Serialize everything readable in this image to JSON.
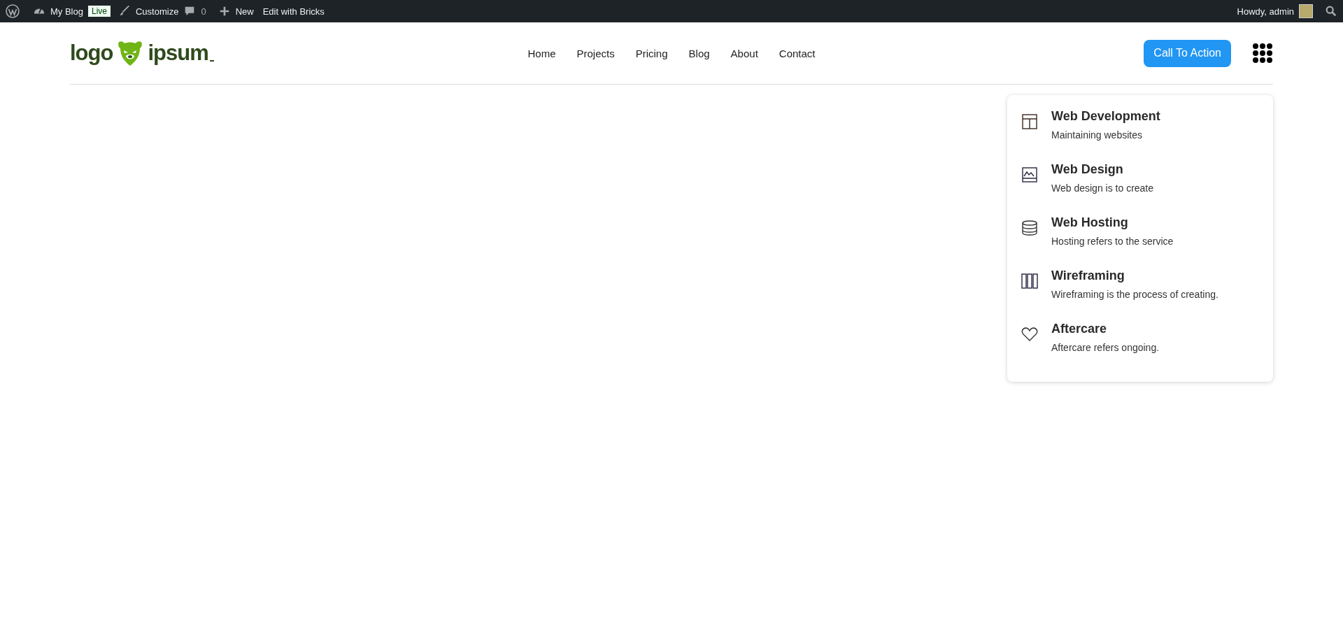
{
  "admin_bar": {
    "site": "My Blog",
    "live_badge": "Live",
    "customize": "Customize",
    "comments_count": "0",
    "new": "New",
    "edit_with_bricks": "Edit with Bricks",
    "greeting": "Howdy, admin"
  },
  "header": {
    "logo": {
      "word_1": "logo",
      "word_2": "ipsum"
    },
    "nav": [
      "Home",
      "Projects",
      "Pricing",
      "Blog",
      "About",
      "Contact"
    ],
    "cta": "Call To Action"
  },
  "dropdown": {
    "items": [
      {
        "title": "Web Development",
        "description": "Maintaining websites"
      },
      {
        "title": "Web Design",
        "description": "Web design is to create"
      },
      {
        "title": "Web Hosting",
        "description": "Hosting refers to the service"
      },
      {
        "title": "Wireframing",
        "description": "Wireframing is the process of creating."
      },
      {
        "title": "Aftercare",
        "description": "Aftercare refers ongoing."
      }
    ]
  }
}
